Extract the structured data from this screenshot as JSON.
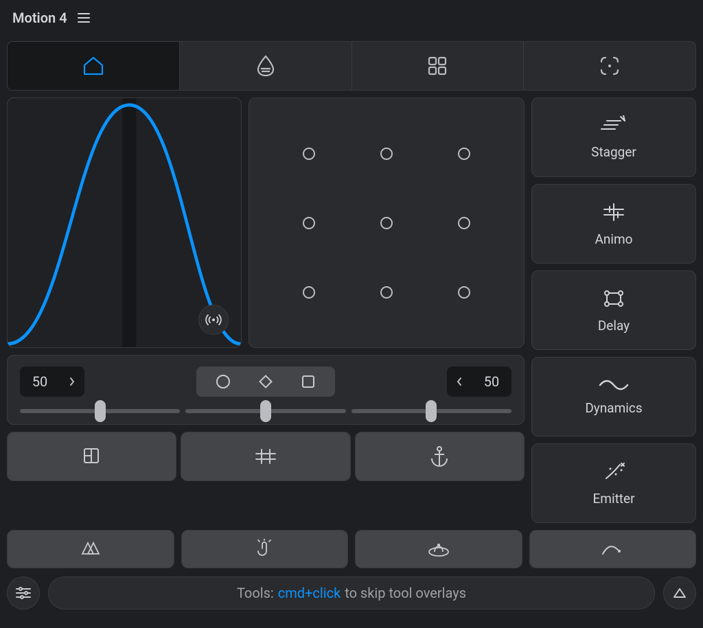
{
  "app": {
    "title": "Motion 4"
  },
  "tabs": {
    "items": [
      "home",
      "drop",
      "grid",
      "focus"
    ],
    "activeIndex": 0
  },
  "curve": {
    "playheadX": 0.52
  },
  "anchor": {
    "rows": 3,
    "cols": 3
  },
  "controls": {
    "leftValue": "50",
    "rightValue": "50",
    "shapes": [
      "circle",
      "diamond",
      "square"
    ],
    "slider1": 50,
    "slider2": 50,
    "slider3": 50
  },
  "tools": [
    "layers",
    "path-text",
    "anchor"
  ],
  "side": {
    "items": [
      {
        "label": "Stagger",
        "icon": "stagger-icon"
      },
      {
        "label": "Animo",
        "icon": "animo-icon"
      },
      {
        "label": "Delay",
        "icon": "delay-icon"
      },
      {
        "label": "Dynamics",
        "icon": "dynamics-icon"
      },
      {
        "label": "Emitter",
        "icon": "emitter-icon"
      }
    ]
  },
  "bottom": [
    "swatches",
    "touch",
    "orbit",
    "curve-path"
  ],
  "hint": {
    "prefix": "Tools:",
    "command": "cmd+click",
    "suffix": "to skip tool overlays"
  },
  "colors": {
    "accent": "#0a93ff"
  }
}
